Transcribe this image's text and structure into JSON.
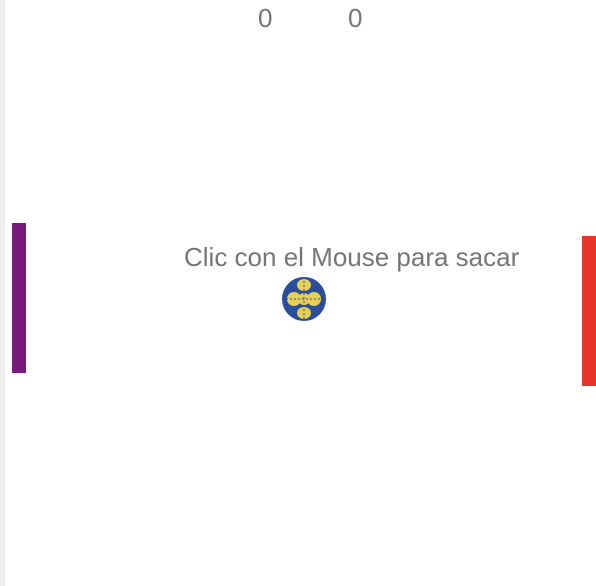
{
  "game": {
    "score_left": "0",
    "score_right": "0",
    "message": "Clic con el Mouse para sacar"
  },
  "colors": {
    "paddle_left": "#78197e",
    "paddle_right": "#e8352a",
    "ball_blue": "#2a4d9c",
    "ball_yellow": "#e7cf55",
    "text": "#767676",
    "background": "#ffffff"
  },
  "icons": {
    "ball": "ball-icon"
  }
}
